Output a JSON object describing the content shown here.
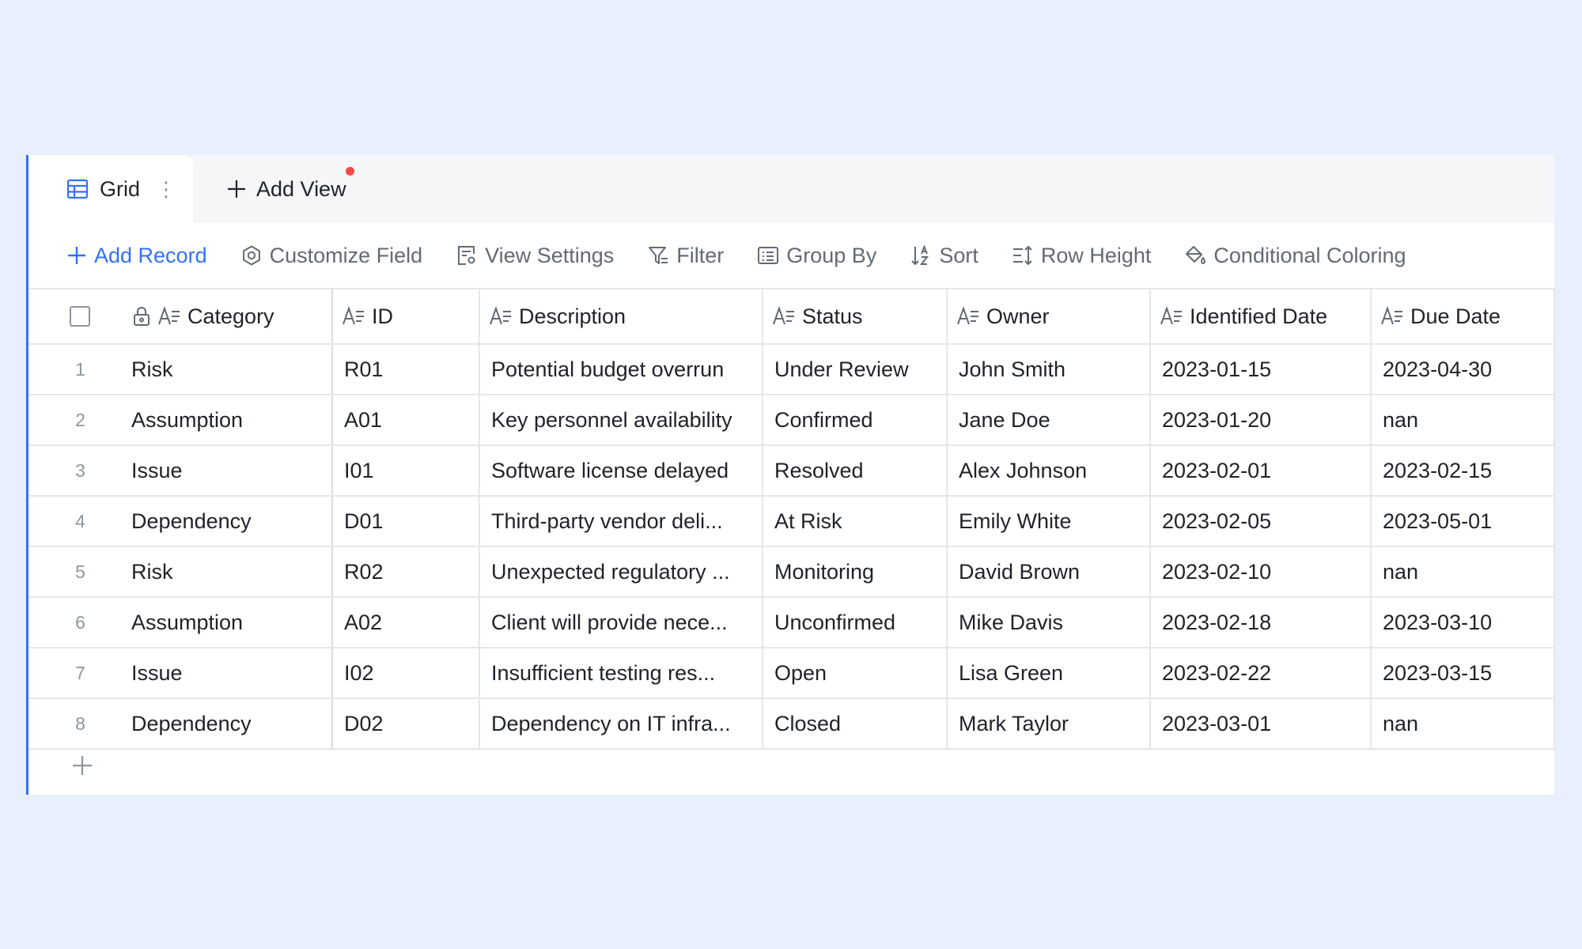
{
  "tabs": {
    "grid_label": "Grid",
    "add_view_label": "Add View"
  },
  "toolbar": {
    "add_record": "Add Record",
    "customize_field": "Customize Field",
    "view_settings": "View Settings",
    "filter": "Filter",
    "group_by": "Group By",
    "sort": "Sort",
    "row_height": "Row Height",
    "conditional_coloring": "Conditional Coloring"
  },
  "columns": [
    "Category",
    "ID",
    "Description",
    "Status",
    "Owner",
    "Identified Date",
    "Due Date"
  ],
  "rows": [
    {
      "num": "1",
      "category": "Risk",
      "id": "R01",
      "description": "Potential budget overrun",
      "status": "Under Review",
      "owner": "John Smith",
      "identified": "2023-01-15",
      "due": "2023-04-30"
    },
    {
      "num": "2",
      "category": "Assumption",
      "id": "A01",
      "description": "Key personnel availability",
      "status": "Confirmed",
      "owner": "Jane Doe",
      "identified": "2023-01-20",
      "due": "nan"
    },
    {
      "num": "3",
      "category": "Issue",
      "id": "I01",
      "description": "Software license delayed",
      "status": "Resolved",
      "owner": "Alex Johnson",
      "identified": "2023-02-01",
      "due": "2023-02-15"
    },
    {
      "num": "4",
      "category": "Dependency",
      "id": "D01",
      "description": "Third-party vendor deli...",
      "status": "At Risk",
      "owner": "Emily White",
      "identified": "2023-02-05",
      "due": "2023-05-01"
    },
    {
      "num": "5",
      "category": "Risk",
      "id": "R02",
      "description": "Unexpected regulatory ...",
      "status": "Monitoring",
      "owner": "David Brown",
      "identified": "2023-02-10",
      "due": "nan"
    },
    {
      "num": "6",
      "category": "Assumption",
      "id": "A02",
      "description": "Client will provide nece...",
      "status": "Unconfirmed",
      "owner": "Mike Davis",
      "identified": "2023-02-18",
      "due": "2023-03-10"
    },
    {
      "num": "7",
      "category": "Issue",
      "id": "I02",
      "description": "Insufficient testing res...",
      "status": "Open",
      "owner": "Lisa Green",
      "identified": "2023-02-22",
      "due": "2023-03-15"
    },
    {
      "num": "8",
      "category": "Dependency",
      "id": "D02",
      "description": "Dependency on IT infra...",
      "status": "Closed",
      "owner": "Mark Taylor",
      "identified": "2023-03-01",
      "due": "nan"
    }
  ],
  "colors": {
    "accent": "#3370ff",
    "background": "#e8effd",
    "notification_dot": "#f54a45"
  }
}
